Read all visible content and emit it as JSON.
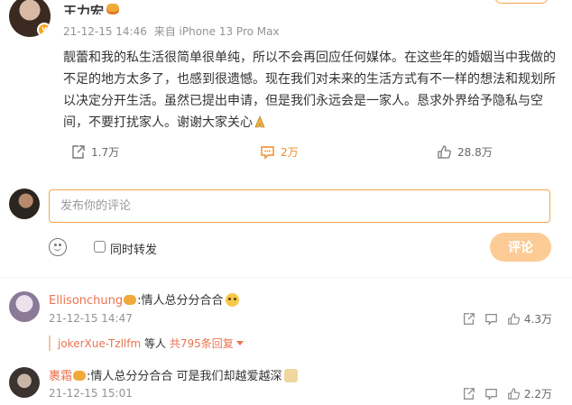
{
  "post": {
    "author": "王力宏",
    "time": "21-12-15 14:46",
    "source": "来自 iPhone 13 Pro Max",
    "text": "靓蕾和我的私生活很简单很单纯，所以不会再回应任何媒体。在这些年的婚姻当中我做的不足的地方太多了，也感到很遗憾。现在我们对未来的生活方式有不一样的想法和规划所以决定分开生活。虽然已提出申请，但是我们永远会是一家人。恳求外界给予隐私与空间，不要打扰家人。谢谢大家关心",
    "reposts": "1.7万",
    "comments": "2万",
    "likes": "28.8万"
  },
  "composer": {
    "placeholder": "发布你的评论",
    "repost_label": "同时转发",
    "submit_label": "评论"
  },
  "comments": [
    {
      "name": "Ellisonchung",
      "text": ":情人总分分合合",
      "time": "21-12-15 14:47",
      "likes": "4.3万",
      "reply_user": "jokerXue-Tzllfm",
      "reply_suffix": " 等人 ",
      "reply_total": "共795条回复"
    },
    {
      "name": "裹霜",
      "text": ":情人总分分合合 可是我们却越爱越深",
      "time": "21-12-15 15:01",
      "likes": "2.2万"
    }
  ],
  "colors": {
    "accent": "#f08c20",
    "username": "#eb7350",
    "input_border": "#f5a54f",
    "submit_bg": "#fccb96"
  }
}
